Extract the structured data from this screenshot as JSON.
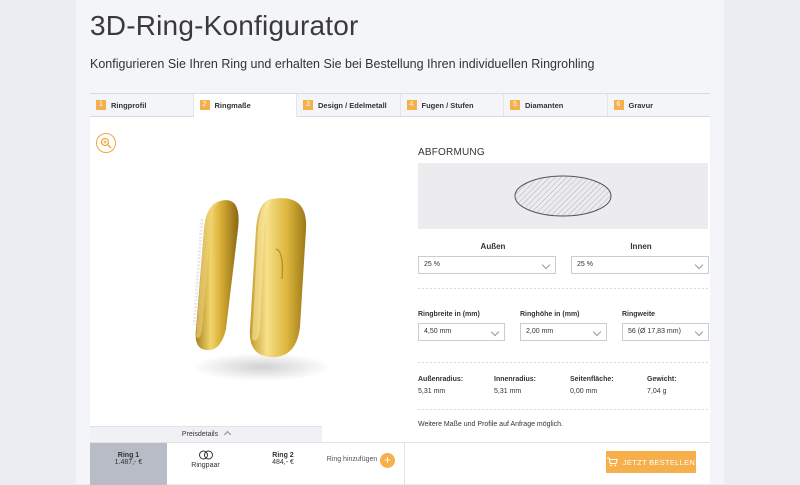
{
  "header": {
    "title": "3D-Ring-Konfigurator",
    "subtitle": "Konfigurieren Sie Ihren Ring und erhalten Sie bei Bestellung Ihren individuellen Ringrohling"
  },
  "tabs": [
    {
      "num": "1",
      "label": "Ringprofil"
    },
    {
      "num": "2",
      "label": "Ringmaße"
    },
    {
      "num": "3",
      "label": "Design / Edelmetall"
    },
    {
      "num": "4",
      "label": "Fugen / Stufen"
    },
    {
      "num": "5",
      "label": "Diamanten"
    },
    {
      "num": "6",
      "label": "Gravur"
    }
  ],
  "active_tab": 1,
  "abformung": {
    "title": "ABFORMUNG",
    "aussen_label": "Außen",
    "innen_label": "Innen",
    "aussen_value": "25 %",
    "innen_value": "25 %"
  },
  "dimensions": {
    "breite_label": "Ringbreite in (mm)",
    "breite_value": "4,50 mm",
    "hoehe_label": "Ringhöhe in (mm)",
    "hoehe_value": "2,00 mm",
    "weite_label": "Ringweite",
    "weite_value": "56 (Ø 17,83 mm)"
  },
  "stats": {
    "aussenradius_label": "Außenradius:",
    "aussenradius_value": "5,31 mm",
    "innenradius_label": "Innenradius:",
    "innenradius_value": "5,31 mm",
    "seitenflaeche_label": "Seitenfläche:",
    "seitenflaeche_value": "0,00 mm",
    "gewicht_label": "Gewicht:",
    "gewicht_value": "7,04 g"
  },
  "note": "Weitere Maße und Profile auf Anfrage möglich.",
  "footer": {
    "preisdetails": "Preisdetails",
    "ring1_label": "Ring 1",
    "ring1_price": "1.487,- €",
    "ringpaar_label": "Ringpaar",
    "ring2_label": "Ring 2",
    "ring2_price": "484,- €",
    "add_ring_label": "Ring hinzufügen",
    "order_label": "JETZT BESTELLEN"
  },
  "colors": {
    "accent": "#f5b04b",
    "gold": "#d9b43a"
  }
}
